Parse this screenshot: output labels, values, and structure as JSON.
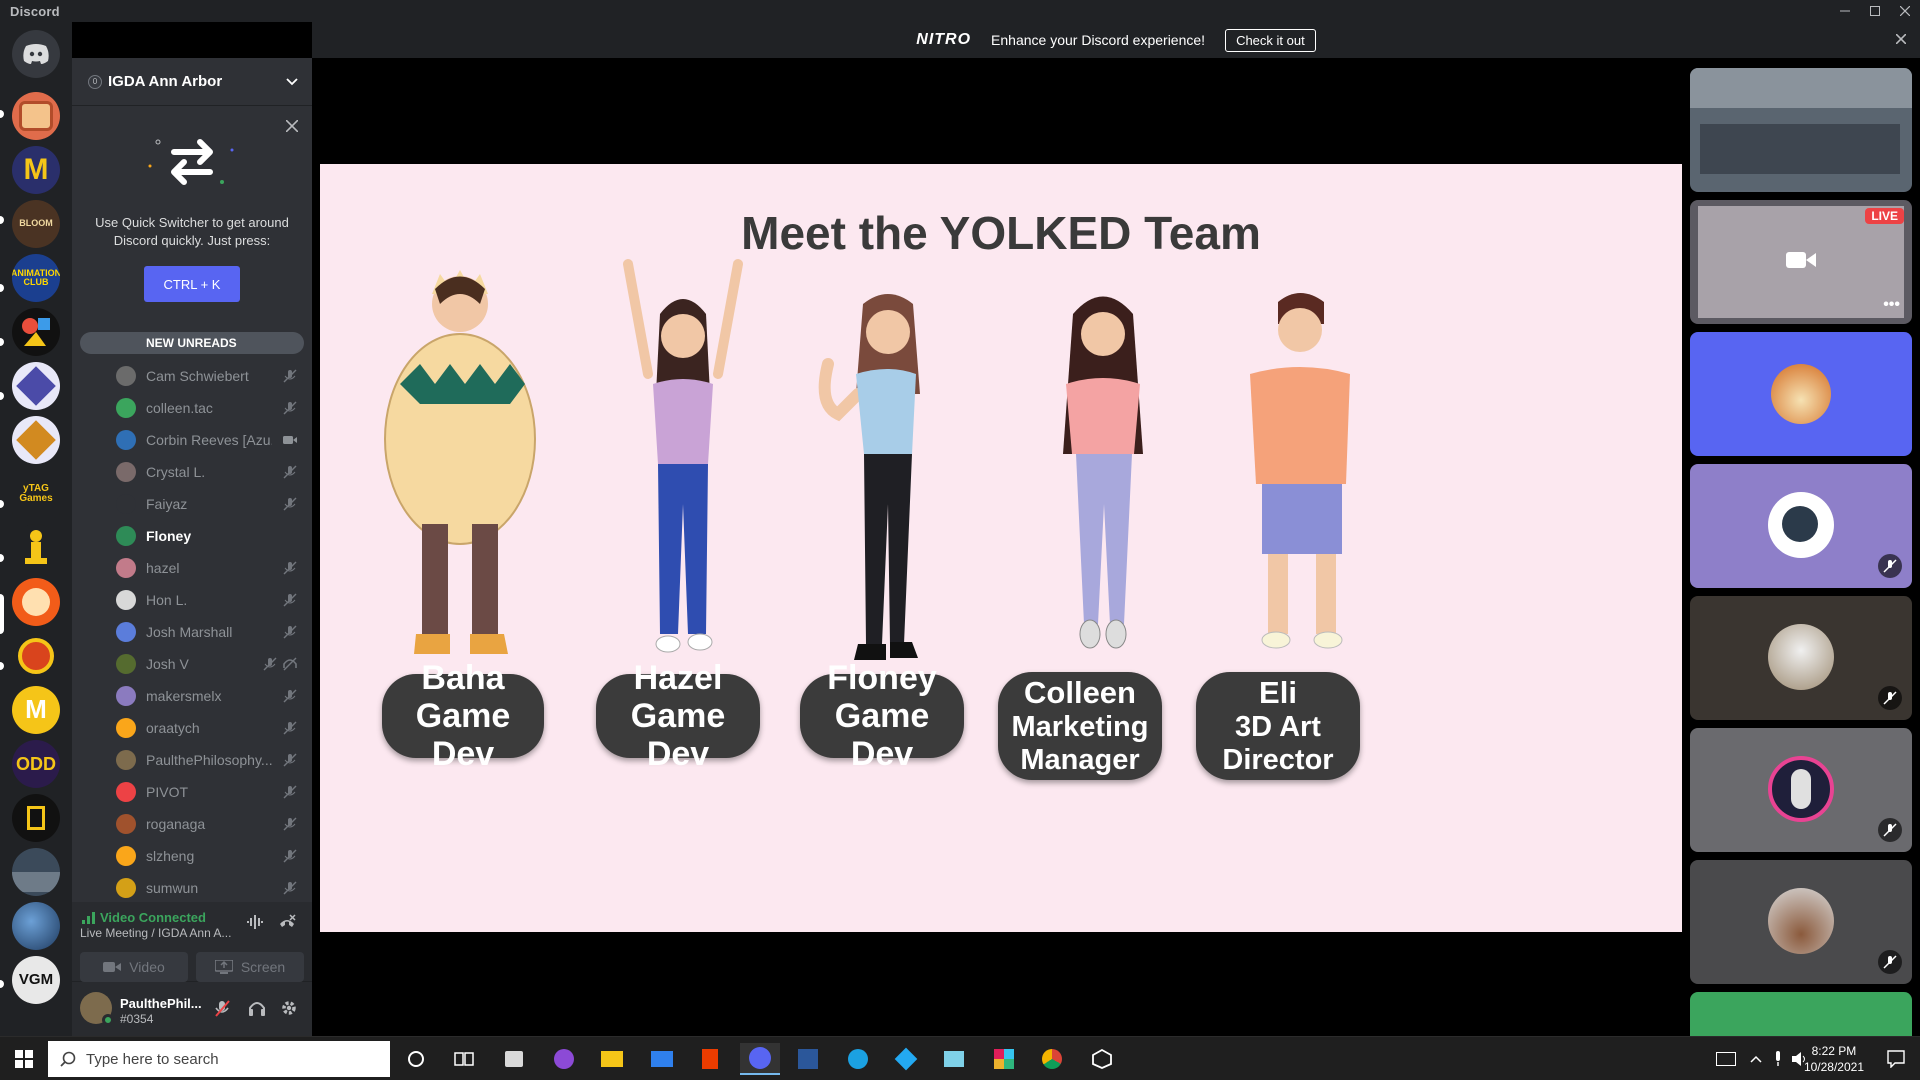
{
  "window": {
    "title": "Discord"
  },
  "nitro": {
    "logo": "NITRO",
    "text": "Enhance your Discord experience!",
    "cta": "Check it out"
  },
  "server": {
    "name": "IGDA Ann Arbor",
    "boost_level": "0"
  },
  "quick_switcher": {
    "text": "Use Quick Switcher to get around Discord quickly. Just press:",
    "shortcut": "CTRL + K"
  },
  "new_unreads": "NEW UNREADS",
  "members": [
    {
      "name": "Cam Schwiebert",
      "muted": true,
      "color": "#6b6b6b"
    },
    {
      "name": "colleen.tac",
      "muted": true,
      "color": "#3ba55d"
    },
    {
      "name": "Corbin Reeves [Azu...",
      "muted": false,
      "video": true,
      "color": "#2f6fb5"
    },
    {
      "name": "Crystal L.",
      "muted": true,
      "color": "#7a6a6a"
    },
    {
      "name": "Faiyaz",
      "muted": true,
      "color": "#2f3136"
    },
    {
      "name": "Floney",
      "muted": false,
      "active": true,
      "color": "#2e8b57"
    },
    {
      "name": "hazel",
      "muted": true,
      "color": "#c27b8a"
    },
    {
      "name": "Hon L.",
      "muted": true,
      "color": "#d8d8d8"
    },
    {
      "name": "Josh Marshall",
      "muted": true,
      "color": "#5b7ddb"
    },
    {
      "name": "Josh V",
      "muted": true,
      "deafened": true,
      "color": "#556b2f"
    },
    {
      "name": "makersmelx",
      "muted": true,
      "color": "#8b7bbf"
    },
    {
      "name": "oraatych",
      "muted": true,
      "color": "#faa61a"
    },
    {
      "name": "PaulthePhilosophy...",
      "muted": true,
      "color": "#7d6b4d"
    },
    {
      "name": "PIVOT",
      "muted": true,
      "color": "#ed4245"
    },
    {
      "name": "roganaga",
      "muted": true,
      "color": "#a0522d"
    },
    {
      "name": "slzheng",
      "muted": true,
      "color": "#faa61a"
    },
    {
      "name": "sumwun",
      "muted": true,
      "color": "#d4a017"
    }
  ],
  "voice": {
    "status": "Video Connected",
    "channel": "Live Meeting / IGDA Ann A...",
    "video_label": "Video",
    "screen_label": "Screen"
  },
  "user": {
    "name": "PaulthePhil...",
    "tag": "#0354"
  },
  "slide": {
    "title": "Meet the YOLKED Team",
    "cards": [
      {
        "lines": [
          "Baha",
          "Game Dev"
        ]
      },
      {
        "lines": [
          "Hazel",
          "Game Dev"
        ]
      },
      {
        "lines": [
          "Floney",
          "Game Dev"
        ]
      },
      {
        "lines": [
          "Colleen",
          "Marketing",
          "Manager"
        ]
      },
      {
        "lines": [
          "Eli",
          "3D Art",
          "Director"
        ]
      }
    ]
  },
  "tiles": {
    "live_badge": "LIVE"
  },
  "taskbar": {
    "search_placeholder": "Type here to search",
    "time": "8:22 PM",
    "date": "10/28/2021"
  },
  "colors": {
    "blurple": "#5865f2",
    "green": "#3ba55d",
    "rail": "#202225",
    "sidebar": "#2f3136",
    "slide_bg": "#fce8f0",
    "card": "#3b3b3b"
  }
}
